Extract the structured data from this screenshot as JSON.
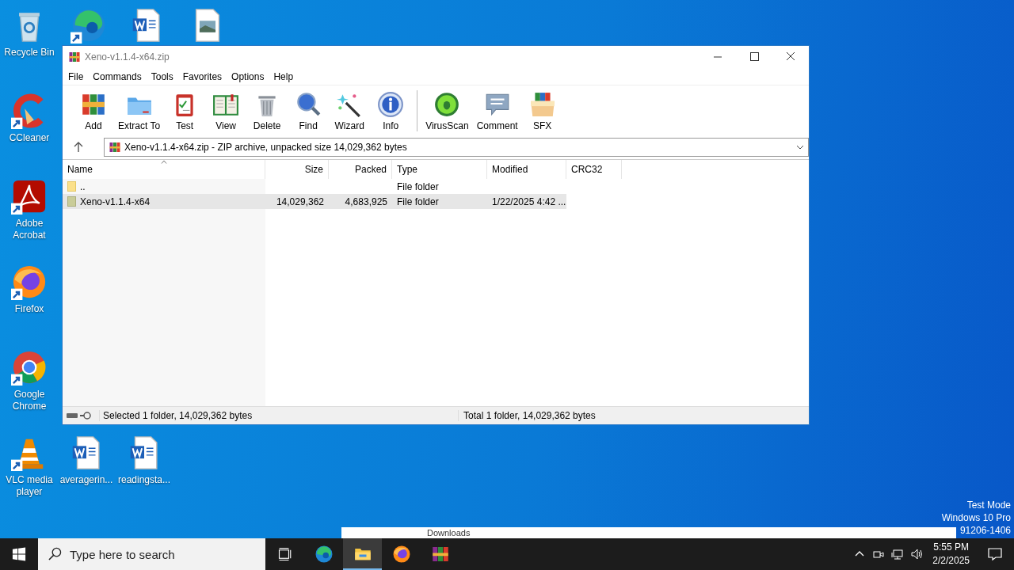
{
  "desktop_icons": [
    {
      "kind": "recycle",
      "label": "Recycle Bin",
      "shortcut": false
    },
    {
      "kind": "edge",
      "shortcut": true
    },
    {
      "kind": "word",
      "shortcut": false
    },
    {
      "kind": "image",
      "shortcut": false
    },
    {
      "kind": "ccleaner",
      "label": "CCleaner",
      "shortcut": true
    },
    {
      "kind": "acrobat",
      "label": "Adobe Acrobat",
      "shortcut": true
    },
    {
      "kind": "firefox",
      "label": "Firefox",
      "shortcut": true
    },
    {
      "kind": "chrome",
      "label": "Google Chrome",
      "shortcut": true
    },
    {
      "kind": "vlc",
      "label": "VLC media player",
      "shortcut": true
    },
    {
      "kind": "word",
      "label": "averagerin...",
      "shortcut": false
    },
    {
      "kind": "word",
      "label": "readingsta...",
      "shortcut": false
    }
  ],
  "window": {
    "title": "Xeno-v1.1.4-x64.zip",
    "menu": [
      "File",
      "Commands",
      "Tools",
      "Favorites",
      "Options",
      "Help"
    ],
    "toolbar": [
      {
        "kind": "add",
        "label": "Add"
      },
      {
        "kind": "extract",
        "label": "Extract To"
      },
      {
        "kind": "test",
        "label": "Test"
      },
      {
        "kind": "view",
        "label": "View"
      },
      {
        "kind": "delete",
        "label": "Delete"
      },
      {
        "kind": "find",
        "label": "Find"
      },
      {
        "kind": "wizard",
        "label": "Wizard"
      },
      {
        "kind": "info",
        "label": "Info"
      },
      {
        "kind": "separator"
      },
      {
        "kind": "virusscan",
        "label": "VirusScan"
      },
      {
        "kind": "comment",
        "label": "Comment"
      },
      {
        "kind": "sfx",
        "label": "SFX"
      }
    ],
    "path": "Xeno-v1.1.4-x64.zip - ZIP archive, unpacked size 14,029,362 bytes",
    "columns": [
      {
        "label": "Name",
        "sorted": true
      },
      {
        "label": "Size",
        "sorted": false
      },
      {
        "label": "Packed",
        "sorted": false
      },
      {
        "label": "Type",
        "sorted": false
      },
      {
        "label": "Modified",
        "sorted": false
      },
      {
        "label": "CRC32",
        "sorted": false
      }
    ],
    "rows": [
      {
        "kind": "parent",
        "name": "..",
        "size": "",
        "packed": "",
        "type": "File folder",
        "modified": "",
        "selected": false
      },
      {
        "kind": "folder",
        "name": "Xeno-v1.1.4-x64",
        "size": "14,029,362",
        "packed": "4,683,925",
        "type": "File folder",
        "modified": "1/22/2025 4:42 ...",
        "selected": true
      }
    ],
    "status_left": "Selected 1 folder, 14,029,362 bytes",
    "status_right": "Total 1 folder, 14,029,362 bytes"
  },
  "background_window": {
    "title": "Downloads"
  },
  "os_watermark": [
    "Test Mode",
    "Windows 10 Pro",
    "91206-1406"
  ],
  "taskbar": {
    "search_placeholder": "Type here to search",
    "apps": [
      {
        "kind": "taskview",
        "active": false
      },
      {
        "kind": "edge",
        "active": false
      },
      {
        "kind": "explorer",
        "active": true
      },
      {
        "kind": "firefox",
        "active": false
      },
      {
        "kind": "winrar",
        "active": false
      }
    ],
    "time": "5:55 PM",
    "date": "2/2/2025"
  }
}
